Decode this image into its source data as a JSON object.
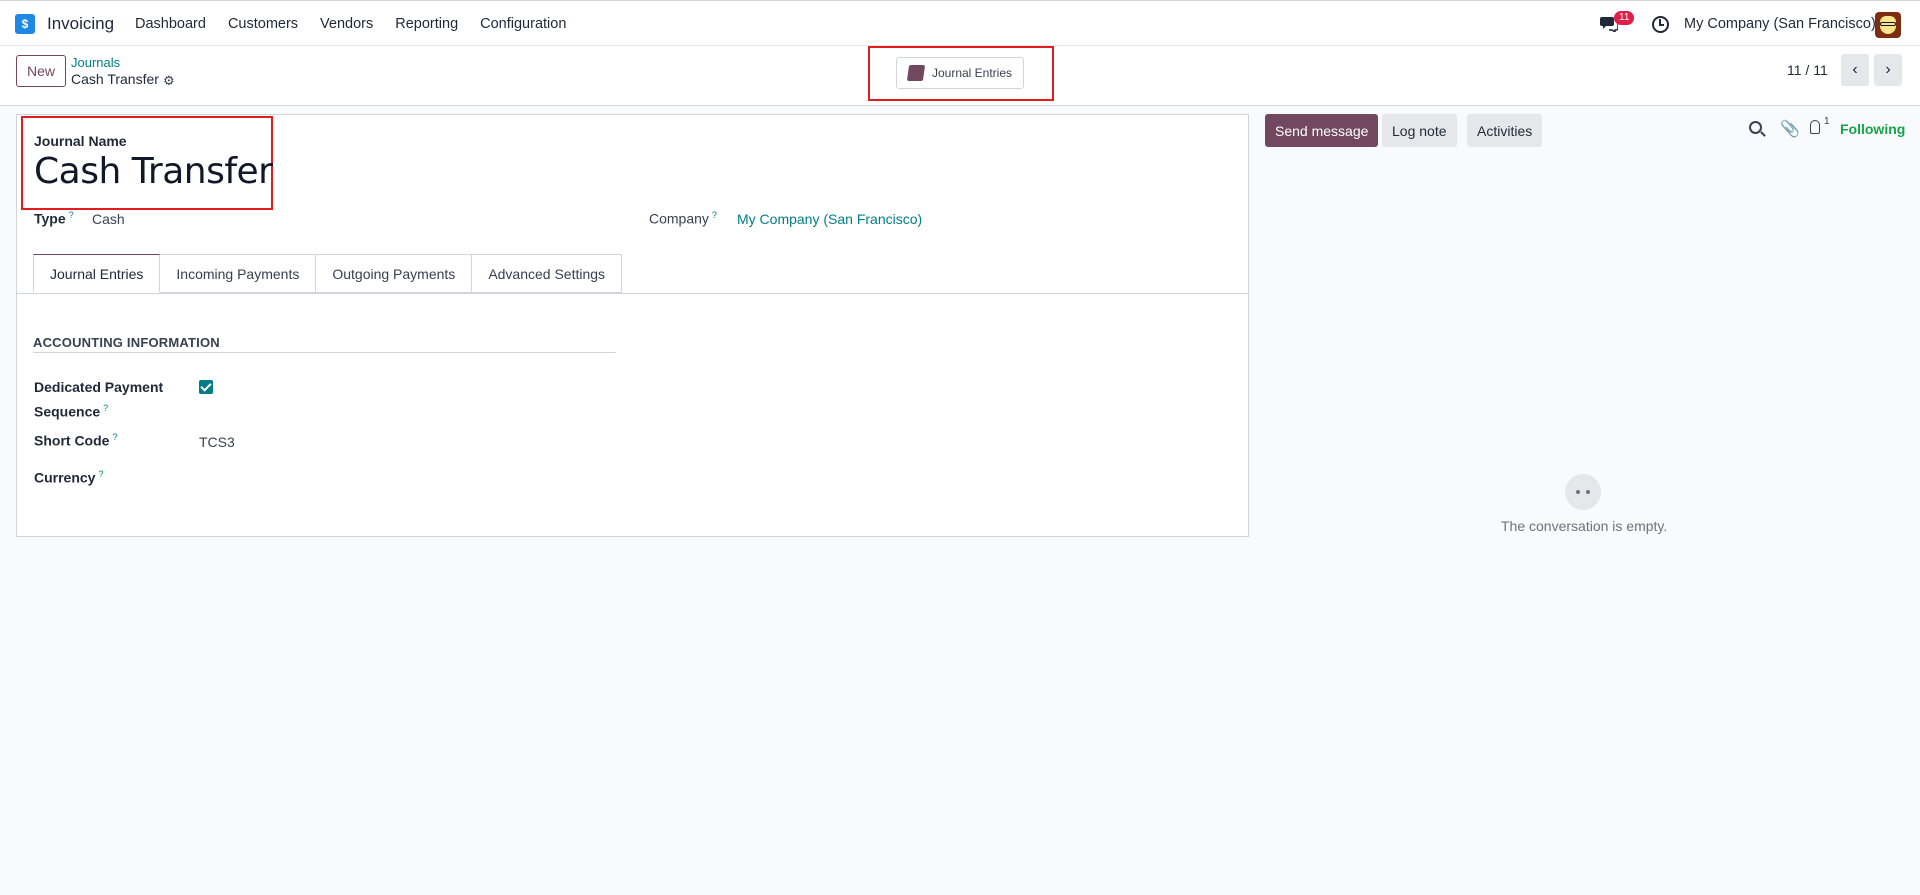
{
  "nav": {
    "app_name": "Invoicing",
    "menu": [
      "Dashboard",
      "Customers",
      "Vendors",
      "Reporting",
      "Configuration"
    ],
    "chat_count": "11",
    "company": "My Company (San Francisco)",
    "icons": [
      "app-logo-icon",
      "chat-icon",
      "clock-icon",
      "avatar"
    ]
  },
  "control": {
    "new_label": "New",
    "breadcrumb_parent": "Journals",
    "breadcrumb_current": "Cash Transfer",
    "smart_button": "Journal Entries",
    "pager": "11 / 11",
    "prev": "‹",
    "next": "›"
  },
  "form": {
    "name_label": "Journal Name",
    "name_value": "Cash Transfer",
    "type_label": "Type",
    "type_value": "Cash",
    "company_label": "Company",
    "company_value": "My Company (San Francisco)",
    "help_mark": "?",
    "tabs": [
      "Journal Entries",
      "Incoming Payments",
      "Outgoing Payments",
      "Advanced Settings"
    ],
    "section_title": "ACCOUNTING INFORMATION",
    "dedicated_label_line1": "Dedicated Payment",
    "dedicated_label_line2": "Sequence",
    "dedicated_checked": true,
    "short_code_label": "Short Code",
    "short_code_value": "TCS3",
    "currency_label": "Currency"
  },
  "chatter": {
    "send_message": "Send message",
    "log_note": "Log note",
    "activities": "Activities",
    "follower_count": "1",
    "following": "Following",
    "empty_text": "The conversation is empty."
  },
  "colors": {
    "primary": "#71485f",
    "link": "#017e84",
    "highlight": "#e11d1d",
    "following": "#16a34a"
  }
}
